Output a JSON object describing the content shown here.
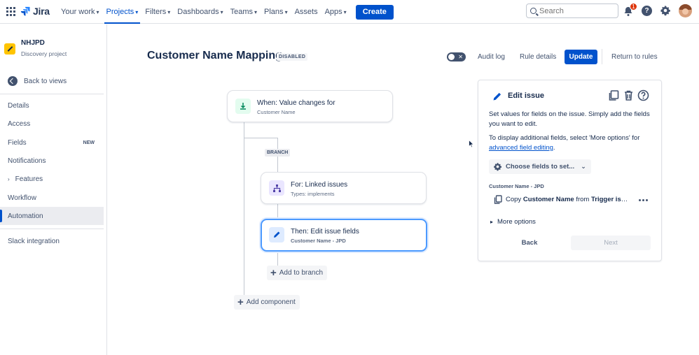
{
  "topnav": {
    "logo_text": "Jira",
    "items": [
      {
        "label": "Your work",
        "dropdown": true
      },
      {
        "label": "Projects",
        "dropdown": true,
        "active": true
      },
      {
        "label": "Filters",
        "dropdown": true
      },
      {
        "label": "Dashboards",
        "dropdown": true
      },
      {
        "label": "Teams",
        "dropdown": true
      },
      {
        "label": "Plans",
        "dropdown": true
      },
      {
        "label": "Assets",
        "dropdown": false
      },
      {
        "label": "Apps",
        "dropdown": true
      }
    ],
    "create_label": "Create",
    "search_placeholder": "Search",
    "notification_count": "1",
    "help_symbol": "?"
  },
  "sidebar": {
    "project_name": "NHJPD",
    "project_type": "Discovery project",
    "back_label": "Back to views",
    "items": [
      {
        "label": "Details"
      },
      {
        "label": "Access"
      },
      {
        "label": "Fields",
        "badge": "NEW"
      },
      {
        "label": "Notifications"
      },
      {
        "label": "Features",
        "expandable": true
      },
      {
        "label": "Workflow"
      },
      {
        "label": "Automation",
        "active": true
      }
    ],
    "bottom_item": "Slack integration"
  },
  "header": {
    "title": "Customer Name Mapping",
    "status": "DISABLED",
    "audit_log": "Audit log",
    "rule_details": "Rule details",
    "update": "Update",
    "return": "Return to rules"
  },
  "flow": {
    "trigger": {
      "title": "When: Value changes for",
      "subtitle": "Customer Name"
    },
    "branch_label": "BRANCH",
    "branch": {
      "title": "For: Linked issues",
      "subtitle": "Types: implements"
    },
    "action": {
      "title": "Then: Edit issue fields",
      "subtitle": "Customer Name - JPD"
    },
    "add_to_branch": "Add to branch",
    "add_component": "Add component"
  },
  "panel": {
    "title": "Edit issue",
    "desc1": "Set values for fields on the issue. Simply add the fields you want to edit.",
    "desc2_prefix": "To display additional fields, select 'More options' for ",
    "desc2_link": "advanced field editing",
    "desc2_suffix": ".",
    "choose_label": "Choose fields to set...",
    "field_label": "Customer Name - JPD",
    "copy_prefix": "Copy ",
    "copy_field": "Customer Name",
    "copy_mid": " from ",
    "copy_source": "Trigger issue",
    "more_options": "More options",
    "back": "Back",
    "next": "Next"
  },
  "colors": {
    "primary": "#0052cc",
    "trigger_icon_bg": "#e3fcef",
    "trigger_icon": "#00875a",
    "branch_icon_bg": "#eae6ff",
    "branch_icon": "#5243aa",
    "action_icon_bg": "#deebff",
    "action_icon": "#0052cc"
  }
}
